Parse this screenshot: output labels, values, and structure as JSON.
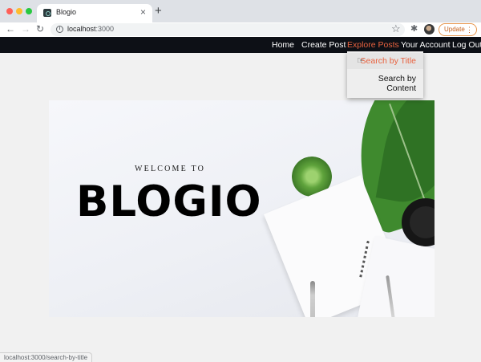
{
  "browser": {
    "tab": {
      "title": "Blogio",
      "close_icon": "×"
    },
    "new_tab_icon": "+",
    "address": {
      "host": "localhost",
      "port": ":3000"
    },
    "update_label": "Update",
    "status_url": "localhost:3000/search-by-title"
  },
  "navbar": {
    "items": [
      {
        "label": "Home"
      },
      {
        "label": "Create Post"
      },
      {
        "label": "Explore Posts",
        "active": true
      },
      {
        "label": "Your Account"
      },
      {
        "label": "Log Out"
      }
    ]
  },
  "dropdown": {
    "items": [
      {
        "label": "Search by Title",
        "hovered": true
      },
      {
        "label": "Search by Content"
      }
    ]
  },
  "hero": {
    "tagline": "WELCOME TO",
    "brand": "BLOGIO"
  },
  "colors": {
    "navbar_bg": "#0d1016",
    "accent": "#e8623f",
    "page_bg": "#f1f1f1"
  },
  "icons": {
    "back": "arrow-left-icon",
    "forward": "arrow-right-icon",
    "reload": "reload-icon",
    "info": "info-icon",
    "bookmark": "star-icon",
    "extensions": "puzzle-icon",
    "cursor": "hand-pointer-icon"
  }
}
